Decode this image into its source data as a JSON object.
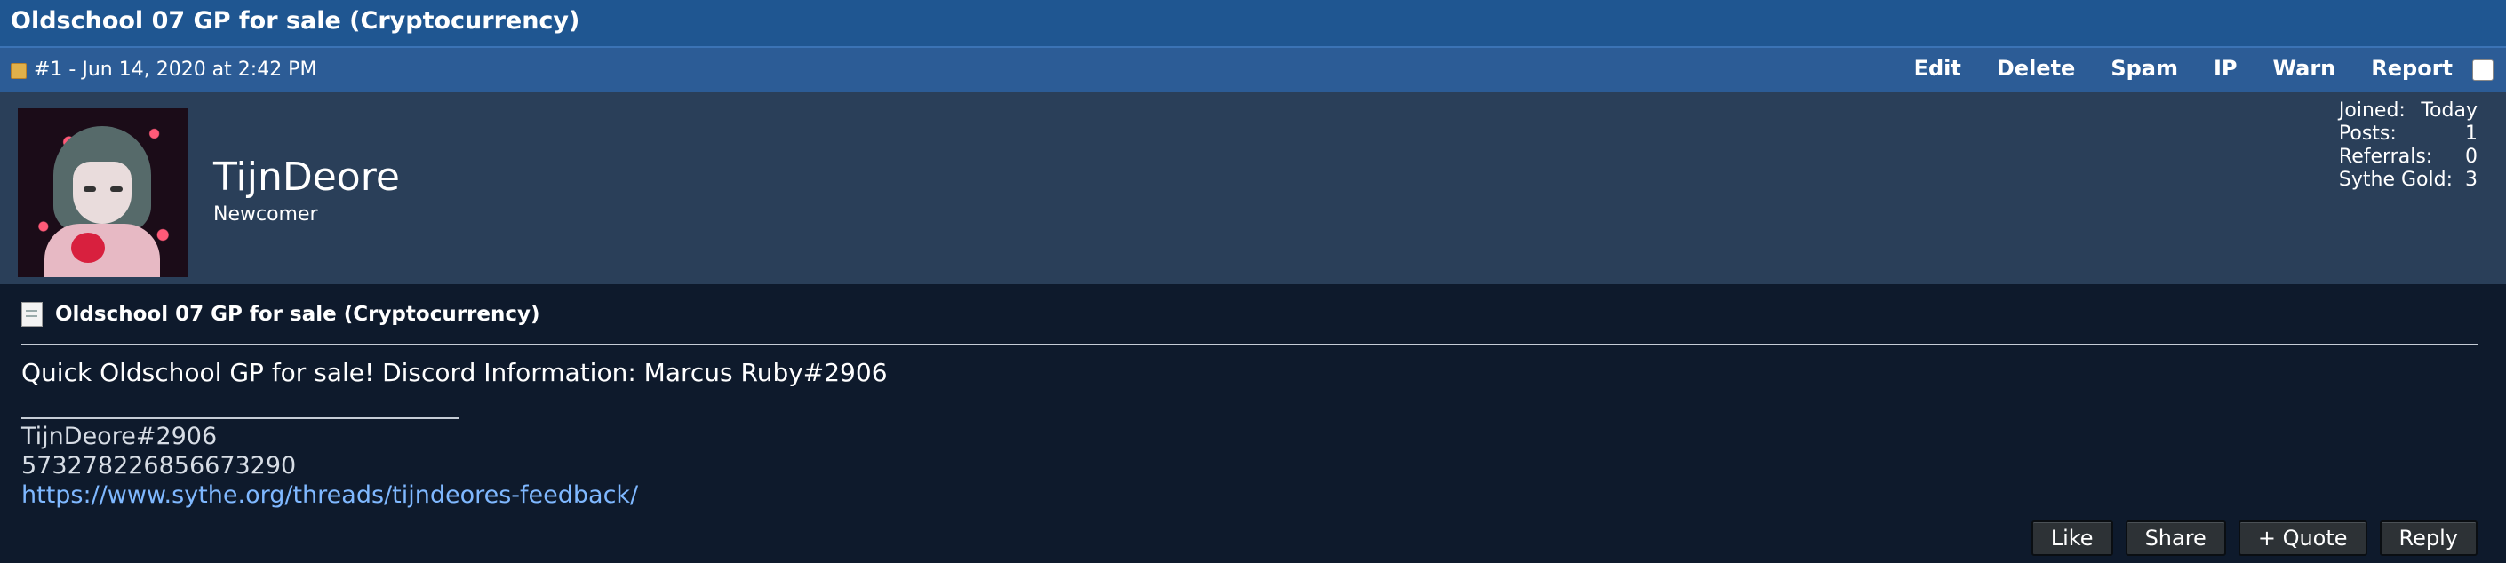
{
  "thread": {
    "title": "Oldschool 07 GP for sale (Cryptocurrency)"
  },
  "post": {
    "meta": "#1 - Jun 14, 2020 at 2:42 PM",
    "mod_actions": [
      "Edit",
      "Delete",
      "Spam",
      "IP",
      "Warn",
      "Report"
    ],
    "report_checked": false,
    "title": "Oldschool 07 GP for sale (Cryptocurrency)",
    "message": "Quick Oldschool GP for sale! Discord Information: Marcus Ruby#2906",
    "signature": {
      "line1": "TijnDeore#2906",
      "line2": "573278226856673290",
      "link": "https://www.sythe.org/threads/tijndeores-feedback/"
    },
    "buttons": [
      "Like",
      "Share",
      "+ Quote",
      "Reply"
    ]
  },
  "user": {
    "name": "TijnDeore",
    "title": "Newcomer",
    "stats": [
      {
        "label": "Joined:",
        "value": "Today"
      },
      {
        "label": "Posts:",
        "value": "1"
      },
      {
        "label": "Referrals:",
        "value": "0"
      },
      {
        "label": "Sythe Gold:",
        "value": "3"
      }
    ]
  },
  "colors": {
    "title_bar": "#1f5691",
    "meta_bar": "#2c5c96",
    "user_panel": "#2a3f59",
    "body_bg": "#0e1a2c",
    "link": "#7fb8ff"
  }
}
